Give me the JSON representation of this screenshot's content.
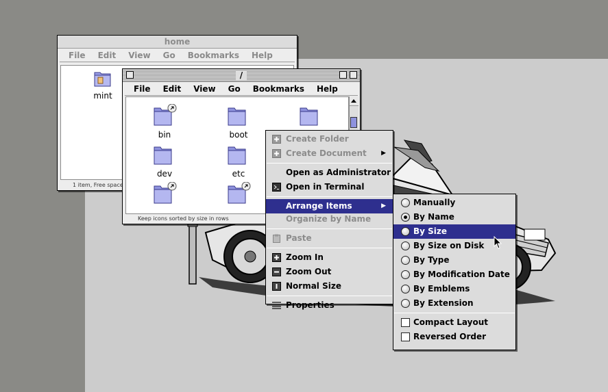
{
  "home_window": {
    "title": "home",
    "menu": [
      "File",
      "Edit",
      "View",
      "Go",
      "Bookmarks",
      "Help"
    ],
    "icon_label": "mint",
    "status": "1 item, Free space"
  },
  "root_window": {
    "title": "/",
    "menu": [
      "File",
      "Edit",
      "View",
      "Go",
      "Bookmarks",
      "Help"
    ],
    "folders": [
      "bin",
      "boot",
      "",
      "dev",
      "etc",
      "",
      ""
    ],
    "status": "Keep icons sorted by size in rows"
  },
  "context_menu": {
    "items": [
      {
        "label": "Create Folder",
        "icon": "plus-icon"
      },
      {
        "label": "Create Document",
        "icon": "plus-icon"
      },
      {
        "label": "Open as Administrator"
      },
      {
        "label": "Open in Terminal",
        "icon": "terminal-icon"
      },
      {
        "label": "Arrange Items"
      },
      {
        "label": "Organize by Name"
      },
      {
        "label": "Paste",
        "icon": "clipboard-icon"
      },
      {
        "label": "Zoom In",
        "icon": "zoom-in-icon"
      },
      {
        "label": "Zoom Out",
        "icon": "zoom-out-icon"
      },
      {
        "label": "Normal Size",
        "icon": "normal-size-icon"
      },
      {
        "label": "Properties",
        "icon": "properties-icon"
      }
    ]
  },
  "arrange_submenu": {
    "items": [
      {
        "label": "Manually",
        "checked": false
      },
      {
        "label": "By Name",
        "checked": true
      },
      {
        "label": "By Size",
        "checked": false
      },
      {
        "label": "By Size on Disk",
        "checked": false
      },
      {
        "label": "By Type",
        "checked": false
      },
      {
        "label": "By Modification Date",
        "checked": false
      },
      {
        "label": "By Emblems",
        "checked": false
      },
      {
        "label": "By Extension",
        "checked": false
      }
    ],
    "toggles": [
      "Compact Layout",
      "Reversed Order"
    ]
  },
  "colors": {
    "desktop_dark": "#8a8a86",
    "desktop_light": "#cccccc",
    "highlight": "#2e2f8e",
    "folder": "#9a9ee6"
  }
}
